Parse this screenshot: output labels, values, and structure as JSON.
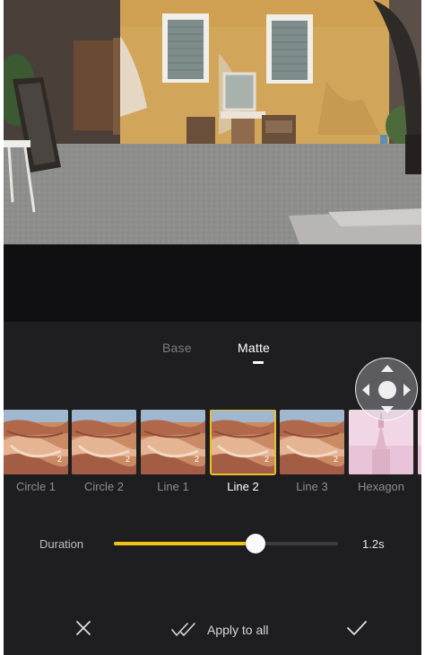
{
  "tabs": [
    {
      "label": "Base",
      "active": false
    },
    {
      "label": "Matte",
      "active": true
    }
  ],
  "transitions": [
    {
      "label": "Circle 1",
      "thumb": "canyon",
      "selected": false
    },
    {
      "label": "Circle 2",
      "thumb": "canyon",
      "selected": false
    },
    {
      "label": "Line 1",
      "thumb": "canyon",
      "selected": false
    },
    {
      "label": "Line 2",
      "thumb": "canyon",
      "selected": true
    },
    {
      "label": "Line 3",
      "thumb": "canyon",
      "selected": false
    },
    {
      "label": "Hexagon",
      "thumb": "temple",
      "selected": false
    },
    {
      "label": "",
      "thumb": "temple",
      "selected": false
    }
  ],
  "duration": {
    "label": "Duration",
    "value_text": "1.2s",
    "slider_fraction": 0.63
  },
  "bottom_bar": {
    "apply_all_label": "Apply to all"
  },
  "icons": {
    "cancel": "close-icon",
    "apply_all": "double-check-icon",
    "confirm": "check-icon",
    "joystick": "directional-pad-icon"
  },
  "colors": {
    "accent": "#f2c316",
    "selection_border": "#e7c02c",
    "panel": "#1e1e21"
  }
}
